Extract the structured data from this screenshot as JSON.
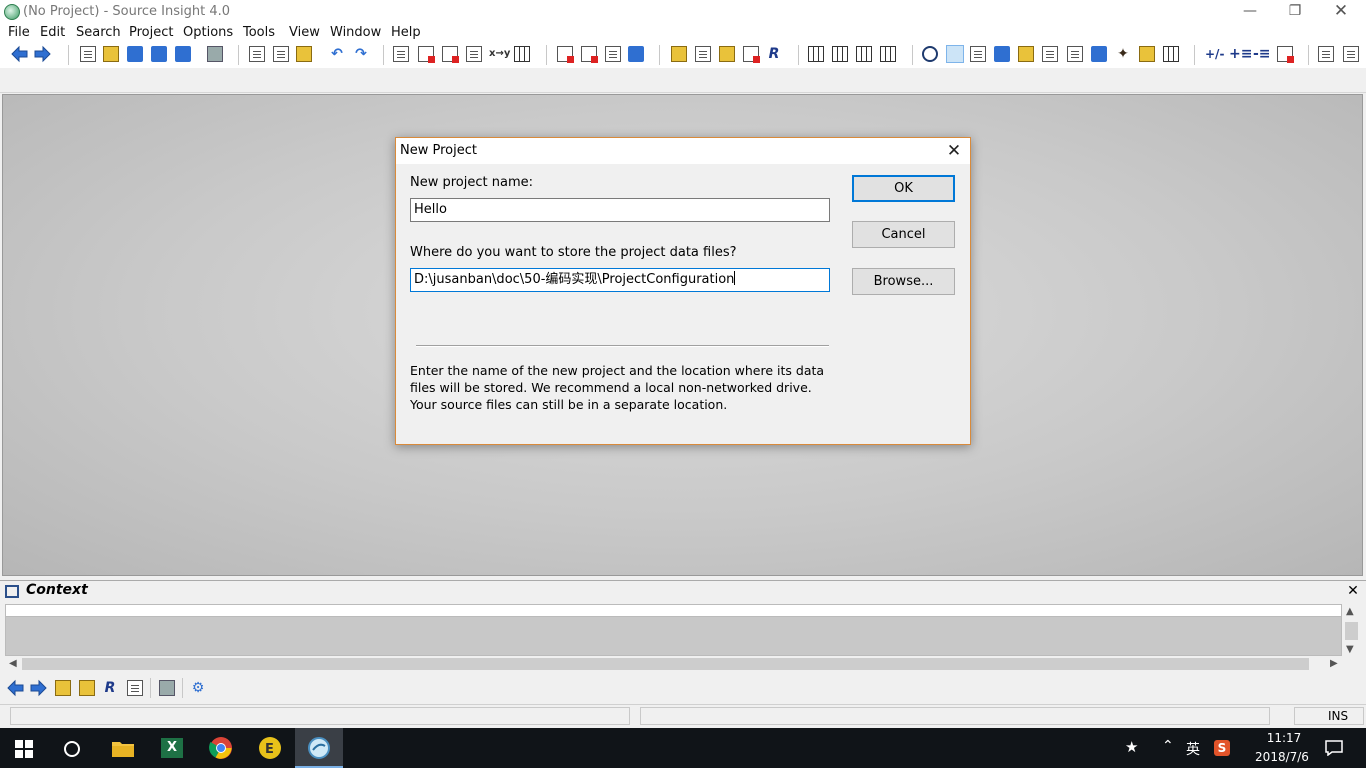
{
  "window": {
    "title": "(No Project) - Source Insight 4.0"
  },
  "menu": [
    "File",
    "Edit",
    "Search",
    "Project",
    "Options",
    "Tools",
    "View",
    "Window",
    "Help"
  ],
  "dialog": {
    "title": "New Project",
    "name_label": "New project name:",
    "name_value": "Hello",
    "location_label": "Where do you want to store the project data files?",
    "location_value": "D:\\jusanban\\doc\\50-编码实现\\ProjectConfiguration",
    "ok_label": "OK",
    "cancel_label": "Cancel",
    "browse_label": "Browse...",
    "help_text": "Enter the name of the new project and the location where its data files will be stored. We recommend a local non-networked drive. Your source files can still be in a separate location."
  },
  "context_panel": {
    "title": "Context"
  },
  "status": {
    "mode": "INS"
  },
  "taskbar": {
    "ime": "英",
    "time": "11:17",
    "date": "2018/7/6"
  },
  "icons": {
    "back": "back-arrow-icon",
    "forward": "forward-arrow-icon",
    "context_panel": "context-window-icon"
  }
}
